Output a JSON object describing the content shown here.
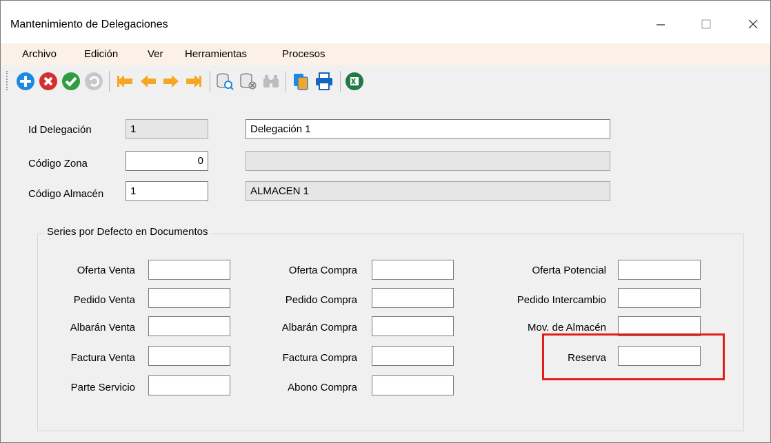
{
  "window": {
    "title": "Mantenimiento de Delegaciones",
    "controls": {
      "minimize": "—",
      "maximize": "☐",
      "close": "✕"
    }
  },
  "menu": [
    "Archivo",
    "Edición",
    "Ver",
    "Herramientas",
    "Procesos"
  ],
  "toolbar": {
    "icons": [
      "add-icon",
      "delete-icon",
      "accept-icon",
      "undo-icon",
      "first-record-icon",
      "previous-record-icon",
      "next-record-icon",
      "last-record-icon",
      "search-database-icon",
      "delete-database-icon",
      "binoculars-icon",
      "copy-icon",
      "print-icon",
      "excel-icon"
    ],
    "colors": {
      "add": "#1e88e5",
      "delete": "#d32f2f",
      "accept": "#2e9d3f",
      "undo": "#c8c8c8",
      "nav": "#f5a623",
      "excel": "#1f7a44"
    }
  },
  "form": {
    "id_delegacion": {
      "label": "Id Delegación",
      "value": "1",
      "name_value": "Delegación 1"
    },
    "codigo_zona": {
      "label": "Código Zona",
      "value": "0",
      "description": ""
    },
    "codigo_almacen": {
      "label": "Código Almacén",
      "value": "1",
      "description": "ALMACEN 1"
    }
  },
  "series": {
    "title": "Series por Defecto en Documentos",
    "col1": [
      {
        "label": "Oferta Venta",
        "value": ""
      },
      {
        "label": "Pedido Venta",
        "value": ""
      },
      {
        "label": "Albarán Venta",
        "value": ""
      },
      {
        "label": "Factura Venta",
        "value": ""
      },
      {
        "label": "Parte Servicio",
        "value": ""
      }
    ],
    "col2": [
      {
        "label": "Oferta Compra",
        "value": ""
      },
      {
        "label": "Pedido Compra",
        "value": ""
      },
      {
        "label": "Albarán Compra",
        "value": ""
      },
      {
        "label": "Factura Compra",
        "value": ""
      },
      {
        "label": "Abono Compra",
        "value": ""
      }
    ],
    "col3": [
      {
        "label": "Oferta Potencial",
        "value": ""
      },
      {
        "label": "Pedido Intercambio",
        "value": ""
      },
      {
        "label": "Mov. de Almacén",
        "value": ""
      },
      {
        "label": "Reserva",
        "value": ""
      }
    ]
  },
  "highlight_color": "#e41b1b"
}
